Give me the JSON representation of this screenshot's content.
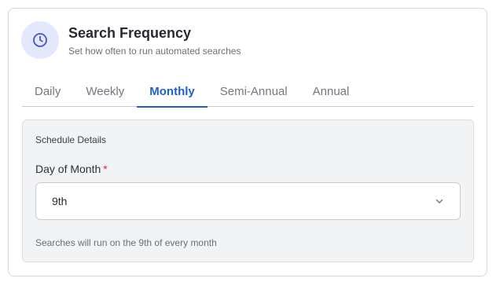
{
  "header": {
    "icon": "clock-icon",
    "title": "Search Frequency",
    "subtitle": "Set how often to run automated searches"
  },
  "tabs": [
    {
      "label": "Daily",
      "active": false
    },
    {
      "label": "Weekly",
      "active": false
    },
    {
      "label": "Monthly",
      "active": true
    },
    {
      "label": "Semi-Annual",
      "active": false
    },
    {
      "label": "Annual",
      "active": false
    }
  ],
  "schedule": {
    "section_title": "Schedule Details",
    "field_label": "Day of Month",
    "required_marker": "*",
    "selected_value": "9th",
    "helper_text": "Searches will run on the 9th of every month"
  },
  "colors": {
    "accent": "#1f5fd6",
    "icon_bg": "#e3e8fc",
    "required": "#d93025"
  }
}
